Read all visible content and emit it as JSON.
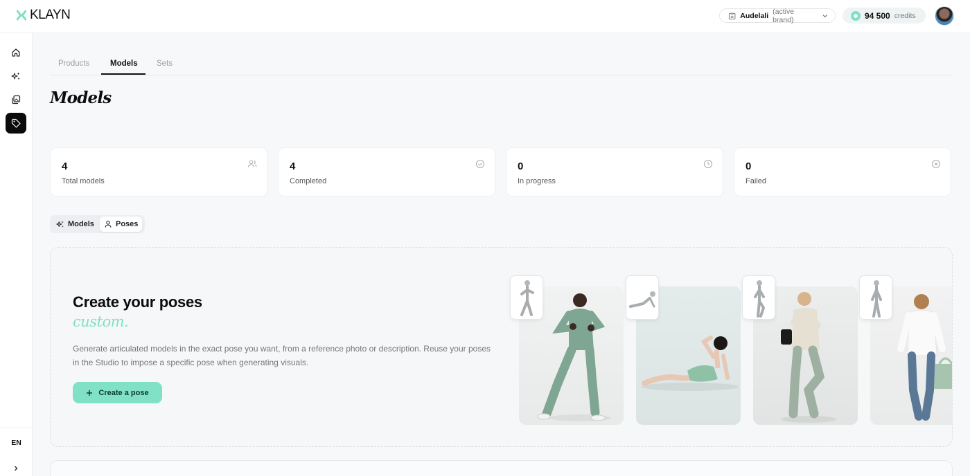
{
  "app": {
    "logo_text": "KLAYN",
    "accent_color": "#7fe0c4"
  },
  "header": {
    "brand_name": "Audelali",
    "brand_suffix": "(active brand)",
    "credits_value": "94 500",
    "credits_label": "credits"
  },
  "sidebar": {
    "items": [
      {
        "name": "home",
        "icon": "home-icon",
        "active": false
      },
      {
        "name": "generate",
        "icon": "sparkles-icon",
        "active": false
      },
      {
        "name": "gallery",
        "icon": "images-icon",
        "active": false
      },
      {
        "name": "catalog",
        "icon": "tag-icon",
        "active": true
      }
    ],
    "language": "EN"
  },
  "tabs": [
    {
      "label": "Products",
      "active": false
    },
    {
      "label": "Models",
      "active": true
    },
    {
      "label": "Sets",
      "active": false
    }
  ],
  "page_title": "Models",
  "stats": [
    {
      "value": "4",
      "label": "Total models",
      "icon": "users-icon"
    },
    {
      "value": "4",
      "label": "Completed",
      "icon": "check-circle-icon"
    },
    {
      "value": "0",
      "label": "In progress",
      "icon": "clock-icon"
    },
    {
      "value": "0",
      "label": "Failed",
      "icon": "x-circle-icon"
    }
  ],
  "segment": {
    "models_label": "Models",
    "poses_label": "Poses",
    "selected": "Poses"
  },
  "hero": {
    "title": "Create your poses",
    "accent": "custom.",
    "description": "Generate articulated models in the exact pose you want, from a reference photo or description. Reuse your poses in the Studio to impose a specific pose when generating visuals.",
    "button_label": "Create a pose"
  }
}
